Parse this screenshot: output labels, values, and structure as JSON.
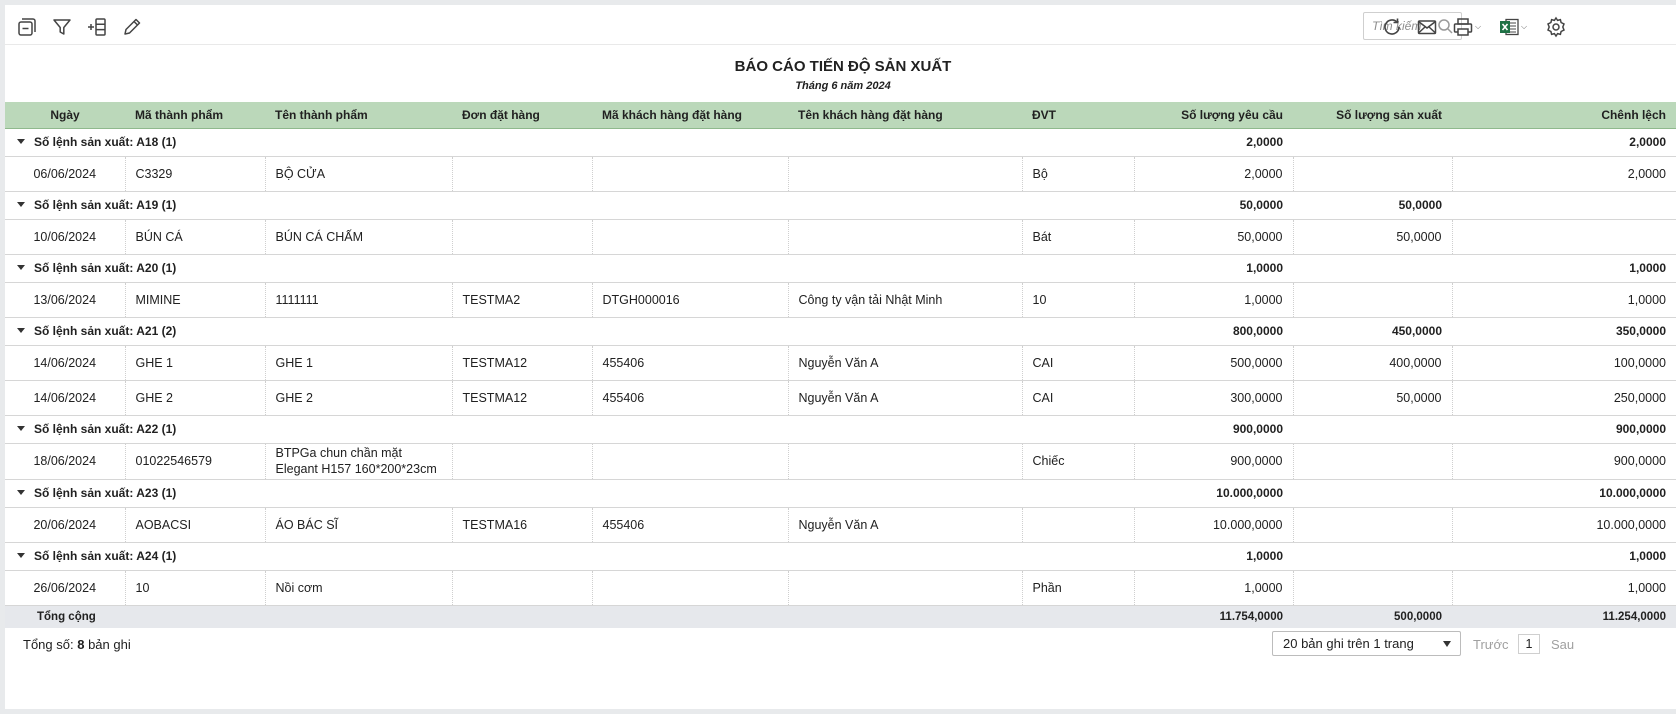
{
  "toolbar": {
    "search_placeholder": "Tìm kiếm"
  },
  "report": {
    "title": "BÁO CÁO TIẾN ĐỘ SẢN XUẤT",
    "subtitle": "Tháng 6 năm 2024"
  },
  "columns": [
    "Ngày",
    "Mã thành phẩm",
    "Tên thành phẩm",
    "Đơn đặt hàng",
    "Mã khách hàng đặt hàng",
    "Tên khách hàng đặt hàng",
    "ĐVT",
    "Số lượng yêu cầu",
    "Số lượng sản xuất",
    "Chênh lệch"
  ],
  "groups": [
    {
      "label": "Số lệnh sản xuất: A18 (1)",
      "req": "2,0000",
      "prod": "",
      "diff": "2,0000",
      "rows": [
        {
          "date": "06/06/2024",
          "code": "C3329",
          "name": "BỘ CỬA",
          "order": "",
          "cust_code": "",
          "cust_name": "",
          "unit": "Bộ",
          "req": "2,0000",
          "prod": "",
          "diff": "2,0000"
        }
      ]
    },
    {
      "label": "Số lệnh sản xuất: A19 (1)",
      "req": "50,0000",
      "prod": "50,0000",
      "diff": "",
      "rows": [
        {
          "date": "10/06/2024",
          "code": "BÚN CÁ",
          "name": "BÚN CÁ CHẤM",
          "order": "",
          "cust_code": "",
          "cust_name": "",
          "unit": "Bát",
          "req": "50,0000",
          "prod": "50,0000",
          "diff": ""
        }
      ]
    },
    {
      "label": "Số lệnh sản xuất: A20 (1)",
      "req": "1,0000",
      "prod": "",
      "diff": "1,0000",
      "rows": [
        {
          "date": "13/06/2024",
          "code": "MIMINE",
          "name": "1111111",
          "order": "TESTMA2",
          "cust_code": "DTGH000016",
          "cust_name": "Công ty vận tải Nhật Minh",
          "unit": "10",
          "req": "1,0000",
          "prod": "",
          "diff": "1,0000"
        }
      ]
    },
    {
      "label": "Số lệnh sản xuất: A21 (2)",
      "req": "800,0000",
      "prod": "450,0000",
      "diff": "350,0000",
      "rows": [
        {
          "date": "14/06/2024",
          "code": "GHE 1",
          "name": "GHE 1",
          "order": "TESTMA12",
          "cust_code": "455406",
          "cust_name": "Nguyễn Văn A",
          "unit": "CAI",
          "req": "500,0000",
          "prod": "400,0000",
          "diff": "100,0000"
        },
        {
          "date": "14/06/2024",
          "code": "GHE 2",
          "name": "GHE 2",
          "order": "TESTMA12",
          "cust_code": "455406",
          "cust_name": "Nguyễn Văn A",
          "unit": "CAI",
          "req": "300,0000",
          "prod": "50,0000",
          "diff": "250,0000"
        }
      ]
    },
    {
      "label": "Số lệnh sản xuất: A22 (1)",
      "req": "900,0000",
      "prod": "",
      "diff": "900,0000",
      "rows": [
        {
          "date": "18/06/2024",
          "code": "01022546579",
          "name_line1": "BTPGa chun chần mặt",
          "name_line2": "Elegant H157 160*200*23cm",
          "order": "",
          "cust_code": "",
          "cust_name": "",
          "unit": "Chiếc",
          "req": "900,0000",
          "prod": "",
          "diff": "900,0000"
        }
      ]
    },
    {
      "label": "Số lệnh sản xuất: A23 (1)",
      "req": "10.000,0000",
      "prod": "",
      "diff": "10.000,0000",
      "rows": [
        {
          "date": "20/06/2024",
          "code": "AOBACSI",
          "name": "ÁO BÁC SĨ",
          "order": "TESTMA16",
          "cust_code": "455406",
          "cust_name": "Nguyễn Văn A",
          "unit": "",
          "req": "10.000,0000",
          "prod": "",
          "diff": "10.000,0000"
        }
      ]
    },
    {
      "label": "Số lệnh sản xuất: A24 (1)",
      "req": "1,0000",
      "prod": "",
      "diff": "1,0000",
      "rows": [
        {
          "date": "26/06/2024",
          "code": "10",
          "name": "Nồi cơm",
          "order": "",
          "cust_code": "",
          "cust_name": "",
          "unit": "Phần",
          "req": "1,0000",
          "prod": "",
          "diff": "1,0000"
        }
      ]
    }
  ],
  "total": {
    "label": "Tổng cộng",
    "req": "11.754,0000",
    "prod": "500,0000",
    "diff": "11.254,0000"
  },
  "footer": {
    "count_prefix": "Tổng số:",
    "count": "8",
    "count_suffix": "bản ghi",
    "page_size": "20 bản ghi trên 1 trang",
    "prev": "Trước",
    "page": "1",
    "next": "Sau"
  }
}
